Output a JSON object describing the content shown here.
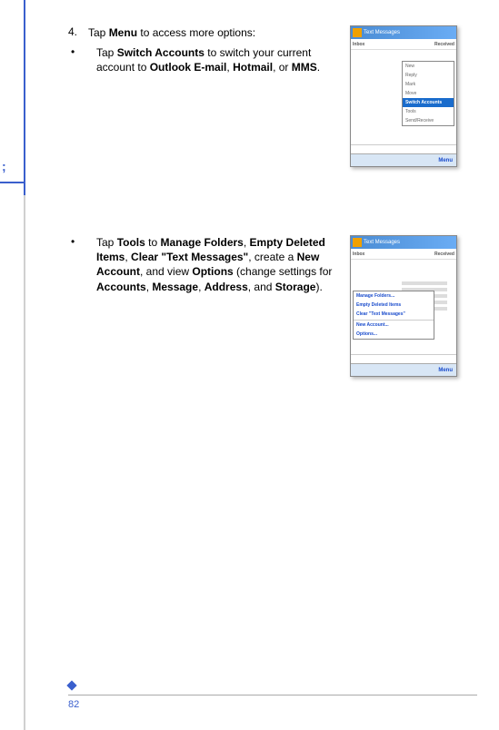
{
  "section1": {
    "num": "4.",
    "numText": "Tap <b>Menu</b> to access more options:",
    "bullet1": "Tap <b>Switch Accounts</b> to switch your current account to <b>Outlook E-mail</b>, <b>Hotmail</b>, or <b>MMS</b>."
  },
  "section2": {
    "bullet1": "Tap <b>Tools</b> to <b>Manage Folders</b>, <b>Empty Deleted Items</b>, <b>Clear \"Text Messages\"</b>, create a <b>New Account</b>, and view <b>Options</b> (change settings for <b>Accounts</b>, <b>Message</b>, <b>Address</b>, and <b>Storage</b>)."
  },
  "mock1": {
    "title": "Text Messages",
    "rowLeft": "Inbox",
    "rowRight": "Received",
    "popup": [
      "New",
      "Reply",
      "Mark",
      "Move",
      "Switch Accounts",
      "Tools",
      "Send/Receive"
    ],
    "popupHlIndex": 4,
    "footer": "Menu"
  },
  "mock2": {
    "title": "Text Messages",
    "rowLeft": "Inbox",
    "rowRight": "Received",
    "popup": [
      "Manage Folders...",
      "Empty Deleted Items",
      "Clear \"Text Messages\"",
      "New Account...",
      "Options..."
    ],
    "footer": "Menu"
  },
  "pageNumber": "82",
  "sidebarChar": ";"
}
